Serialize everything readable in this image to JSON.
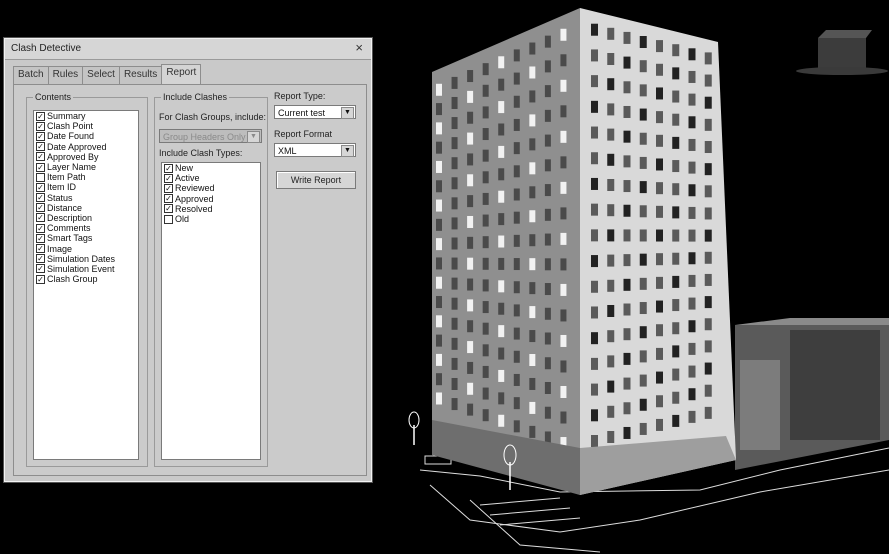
{
  "dialog": {
    "title": "Clash Detective",
    "close_glyph": "×",
    "tabs": [
      "Batch",
      "Rules",
      "Select",
      "Results",
      "Report"
    ],
    "active_tab": "Report"
  },
  "contents": {
    "legend": "Contents",
    "items": [
      {
        "label": "Summary",
        "checked": true
      },
      {
        "label": "Clash Point",
        "checked": true
      },
      {
        "label": "Date Found",
        "checked": true
      },
      {
        "label": "Date Approved",
        "checked": true
      },
      {
        "label": "Approved By",
        "checked": true
      },
      {
        "label": "Layer Name",
        "checked": true
      },
      {
        "label": "Item Path",
        "checked": false
      },
      {
        "label": "Item ID",
        "checked": true
      },
      {
        "label": "Status",
        "checked": true
      },
      {
        "label": "Distance",
        "checked": true
      },
      {
        "label": "Description",
        "checked": true
      },
      {
        "label": "Comments",
        "checked": true
      },
      {
        "label": "Smart Tags",
        "checked": true
      },
      {
        "label": "Image",
        "checked": true
      },
      {
        "label": "Simulation Dates",
        "checked": true
      },
      {
        "label": "Simulation Event",
        "checked": true
      },
      {
        "label": "Clash Group",
        "checked": true
      }
    ]
  },
  "include_clashes": {
    "legend": "Include Clashes",
    "clash_groups_label": "For Clash Groups, include:",
    "clash_groups_value": "Group Headers Only",
    "types_label": "Include Clash Types:",
    "types": [
      {
        "label": "New",
        "checked": true
      },
      {
        "label": "Active",
        "checked": true
      },
      {
        "label": "Reviewed",
        "checked": true
      },
      {
        "label": "Approved",
        "checked": true
      },
      {
        "label": "Resolved",
        "checked": true
      },
      {
        "label": "Old",
        "checked": false
      }
    ]
  },
  "report_type": {
    "label": "Report Type:",
    "value": "Current test"
  },
  "report_format": {
    "label": "Report Format",
    "value": "XML"
  },
  "write_button": "Write Report",
  "colors": {
    "dialog_bg": "#c9c9c9",
    "viewport_bg": "#000000"
  }
}
